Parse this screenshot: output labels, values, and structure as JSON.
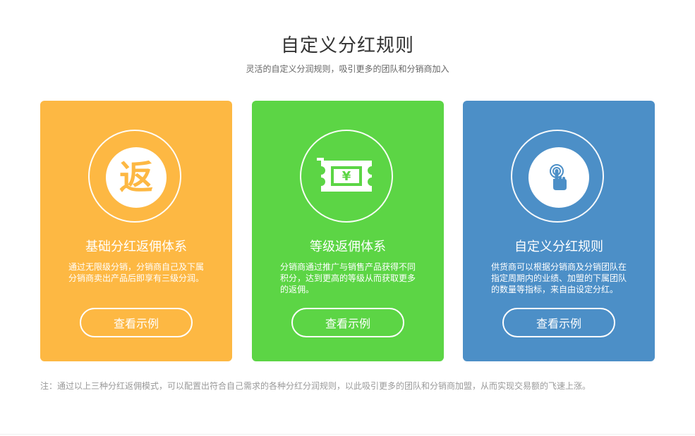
{
  "header": {
    "title": "自定义分红规则",
    "subtitle": "灵活的自定义分润规则，吸引更多的团队和分销商加入"
  },
  "cards": [
    {
      "icon": "fan-rebate-icon",
      "icon_char": "返",
      "title": "基础分红返佣体系",
      "description": "通过无限级分销，分销商自己及下属分销商卖出产品后即享有三级分润。",
      "button_label": "查看示例",
      "color": "#fdb843"
    },
    {
      "icon": "ticket-yen-icon",
      "icon_char": "¥",
      "title": "等级返佣体系",
      "description": "分销商通过推广与销售产品获得不同积分，达到更高的等级从而获取更多的返佣。",
      "button_label": "查看示例",
      "color": "#5cd545"
    },
    {
      "icon": "touch-hand-icon",
      "title": "自定义分红规则",
      "description": "供货商可以根据分销商及分销团队在指定周期内的业绩、加盟的下属团队的数量等指标，来自由设定分红。",
      "button_label": "查看示例",
      "color": "#4c8fc7"
    }
  ],
  "note": "注：通过以上三种分红返佣模式，可以配置出符合自己需求的各种分红分润规则，以此吸引更多的团队和分销商加盟，从而实现交易额的飞速上涨。"
}
